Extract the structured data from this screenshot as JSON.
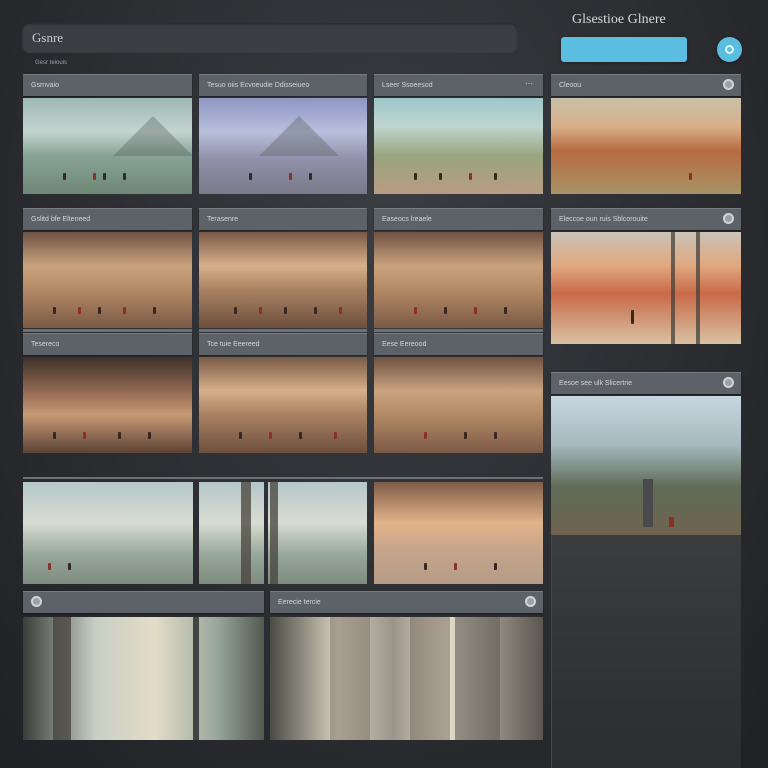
{
  "header": {
    "search_placeholder": "Gsnre",
    "app_title": "Glsestioe Glnere",
    "primary_button": "",
    "section_label": "Gesr teiouis"
  },
  "cards": [
    {
      "id": "c1",
      "title": "Gsrnvaio",
      "icon": false
    },
    {
      "id": "c2",
      "title": "Tesuo oiis Ecvoeudie Ddisseiueo",
      "icon": false
    },
    {
      "id": "c3",
      "title": "Lseer Ssoeesod",
      "icon": true
    },
    {
      "id": "c4",
      "title": "Cleoou",
      "icon": true
    },
    {
      "id": "c5",
      "title": "Gslitd bfe Elteneed",
      "icon": false
    },
    {
      "id": "c6",
      "title": "Terasenre",
      "icon": false
    },
    {
      "id": "c7",
      "title": "Easeocs lreaele",
      "icon": false
    },
    {
      "id": "c8",
      "title": "Eleccoe oun ruis Sblcorouite",
      "icon": true
    },
    {
      "id": "c9",
      "title": "Tesereco",
      "icon": false
    },
    {
      "id": "c10",
      "title": "Tce tuie Eeereed",
      "icon": false
    },
    {
      "id": "c11",
      "title": "Eese Eereood",
      "icon": false
    },
    {
      "id": "c12",
      "title": "Eesoe see ulk Slicertrie",
      "icon": true
    },
    {
      "id": "c13",
      "title": "",
      "icon": true
    },
    {
      "id": "c14",
      "title": "Eerecie tercie",
      "icon": true
    }
  ],
  "colors": {
    "accent": "#5bbde0",
    "header_bar": "#5d6168",
    "background": "#2a2c30"
  }
}
